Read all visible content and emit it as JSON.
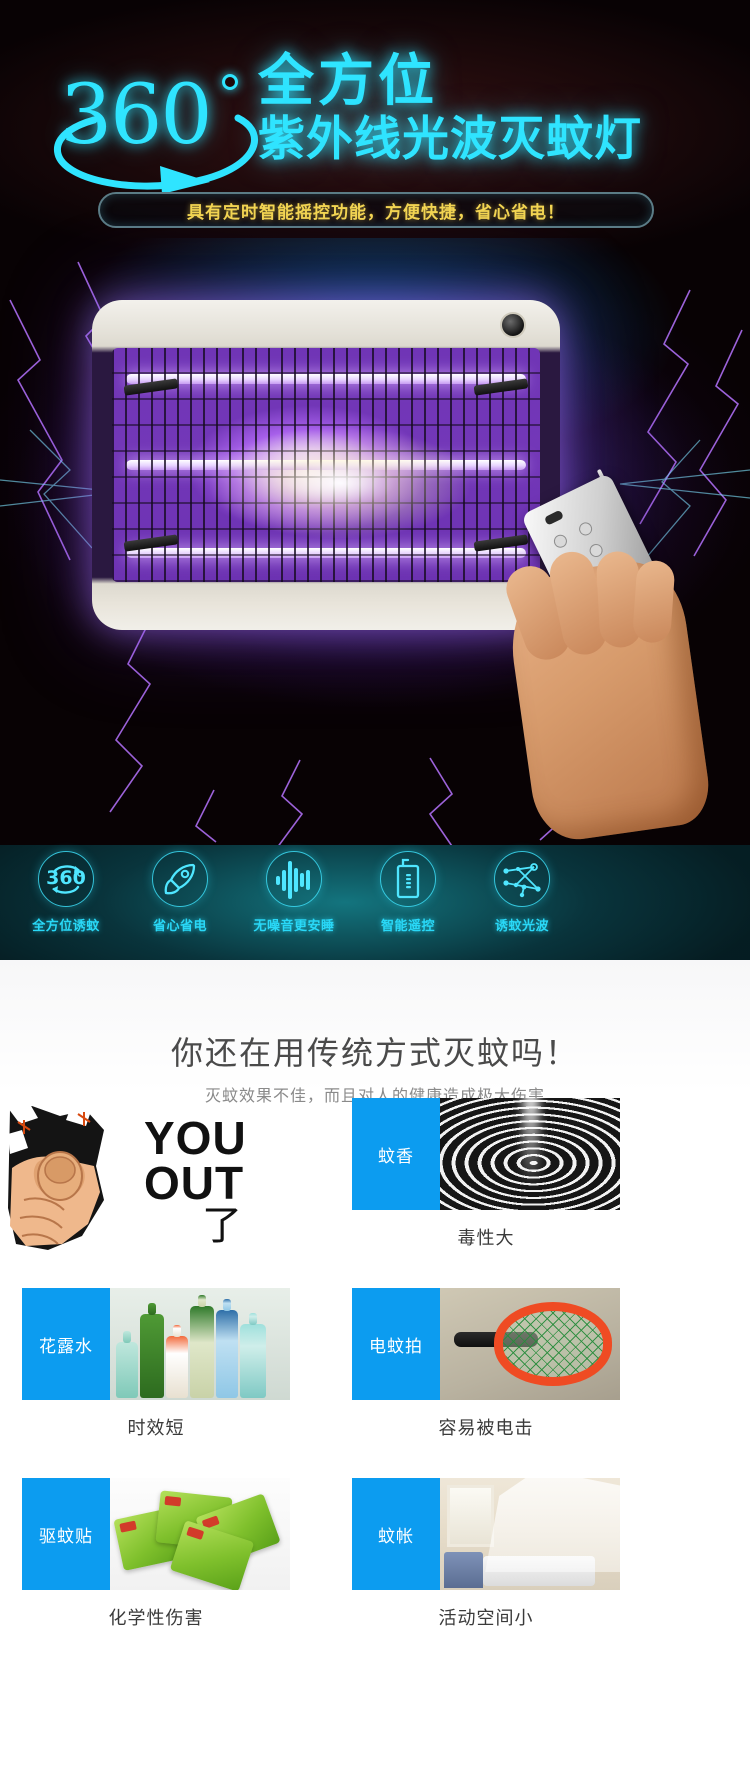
{
  "hero": {
    "deg_number": "360",
    "degree_symbol_icon": "degree-circle-icon",
    "title_line1": "全方位",
    "title_line2": "紫外线光波灭蚊灯",
    "banner": "具有定时智能摇控功能，方便快捷，省心省电！",
    "accent_color": "#2fe4ff",
    "banner_text_color": "#f3d552",
    "background_color": "#07060f",
    "product_image_alt": "紫外线灭蚊灯",
    "remote_image_alt": "手持遥控器"
  },
  "features": {
    "background_color": "#0a3f47",
    "label_color": "#29d8f7",
    "items": [
      {
        "icon": "rotate-360-icon",
        "glyph": "360",
        "label": "全方位诱蚊"
      },
      {
        "icon": "rocket-icon",
        "glyph": "",
        "label": "省心省电"
      },
      {
        "icon": "sound-wave-icon",
        "glyph": "",
        "label": "无噪音更安睡"
      },
      {
        "icon": "remote-control-icon",
        "glyph": "",
        "label": "智能遥控"
      },
      {
        "icon": "light-wave-network-icon",
        "glyph": "",
        "label": "诱蚊光波"
      }
    ]
  },
  "comparison": {
    "heading": "你还在用传统方式灭蚊吗！",
    "subheading": "灭蚊效果不佳，而且对人的健康造成极大伤害",
    "tag_color": "#0c9cf0",
    "callout": {
      "fist_icon": "pointing-fist-icon",
      "line1": "YOU",
      "line2": "OUT",
      "line3": "了"
    },
    "cards": [
      {
        "tag": "蚊香",
        "caption": "毒性大",
        "photo": "mosquito-coil-photo"
      },
      {
        "tag": "花露水",
        "caption": "时效短",
        "photo": "repellent-bottles-photo"
      },
      {
        "tag": "电蚊拍",
        "caption": "容易被电击",
        "photo": "electric-swatter-photo"
      },
      {
        "tag": "驱蚊贴",
        "caption": "化学性伤害",
        "photo": "repellent-patch-photo"
      },
      {
        "tag": "蚊帐",
        "caption": "活动空间小",
        "photo": "mosquito-net-photo"
      }
    ]
  }
}
